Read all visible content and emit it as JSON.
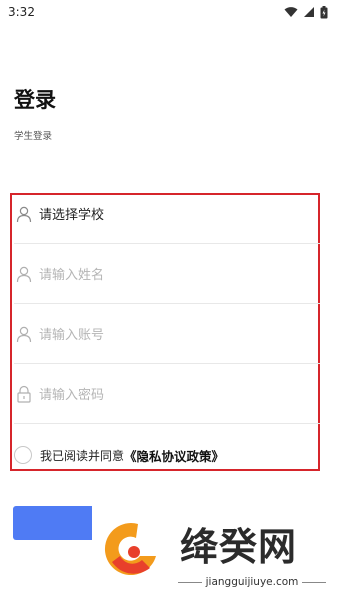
{
  "status_bar": {
    "time": "3:32"
  },
  "header": {
    "title": "登录",
    "subtitle": "学生登录"
  },
  "form": {
    "school": {
      "value": "请选择学校"
    },
    "name": {
      "placeholder": "请输入姓名"
    },
    "account": {
      "placeholder": "请输入账号"
    },
    "password": {
      "placeholder": "请输入密码"
    }
  },
  "agreement": {
    "text": "我已阅读并同意",
    "policy_link": "《隐私协议政策》"
  },
  "watermark": {
    "name": "绛癸网",
    "url": "jiangguijiuye.com"
  },
  "colors": {
    "accent": "#4f7bf4",
    "highlight_border": "#d6252b"
  }
}
